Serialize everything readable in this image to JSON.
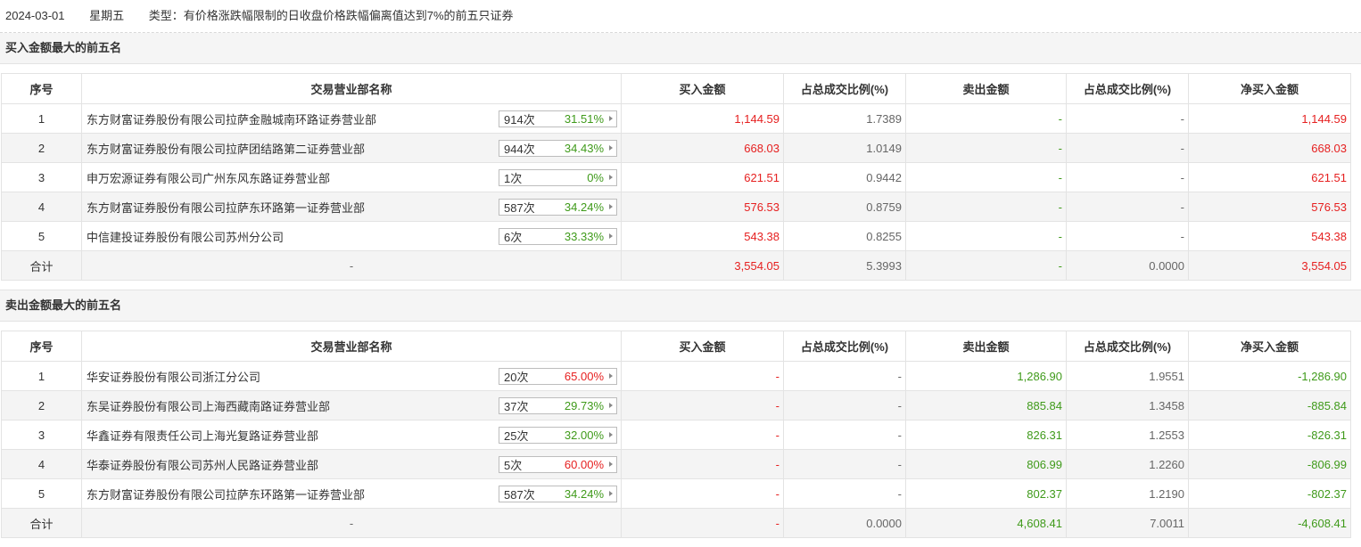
{
  "header": {
    "date": "2024-03-01",
    "weekday": "星期五",
    "type_text": "类型：有价格涨跌幅限制的日收盘价格跌幅偏离值达到7%的前五只证券"
  },
  "columns": [
    "序号",
    "交易营业部名称",
    "买入金额",
    "占总成交比例(%)",
    "卖出金额",
    "占总成交比例(%)",
    "净买入金额"
  ],
  "buy_section": {
    "title": "买入金额最大的前五名",
    "rows": [
      {
        "no": "1",
        "name": "东方财富证券股份有限公司拉萨金融城南环路证券营业部",
        "count": "914次",
        "rate": "31.51%",
        "buy": "1,144.59",
        "buy_pct": "1.7389",
        "sell": "-",
        "sell_pct": "-",
        "net": "1,144.59"
      },
      {
        "no": "2",
        "name": "东方财富证券股份有限公司拉萨团结路第二证券营业部",
        "count": "944次",
        "rate": "34.43%",
        "buy": "668.03",
        "buy_pct": "1.0149",
        "sell": "-",
        "sell_pct": "-",
        "net": "668.03"
      },
      {
        "no": "3",
        "name": "申万宏源证券有限公司广州东风东路证券营业部",
        "count": "1次",
        "rate": "0%",
        "buy": "621.51",
        "buy_pct": "0.9442",
        "sell": "-",
        "sell_pct": "-",
        "net": "621.51"
      },
      {
        "no": "4",
        "name": "东方财富证券股份有限公司拉萨东环路第一证券营业部",
        "count": "587次",
        "rate": "34.24%",
        "buy": "576.53",
        "buy_pct": "0.8759",
        "sell": "-",
        "sell_pct": "-",
        "net": "576.53"
      },
      {
        "no": "5",
        "name": "中信建投证券股份有限公司苏州分公司",
        "count": "6次",
        "rate": "33.33%",
        "buy": "543.38",
        "buy_pct": "0.8255",
        "sell": "-",
        "sell_pct": "-",
        "net": "543.38"
      }
    ],
    "total": {
      "label": "合计",
      "name": "-",
      "buy": "3,554.05",
      "buy_pct": "5.3993",
      "sell": "-",
      "sell_pct": "0.0000",
      "net": "3,554.05"
    }
  },
  "sell_section": {
    "title": "卖出金额最大的前五名",
    "rows": [
      {
        "no": "1",
        "name": "华安证券股份有限公司浙江分公司",
        "count": "20次",
        "rate": "65.00%",
        "buy": "-",
        "buy_pct": "-",
        "sell": "1,286.90",
        "sell_pct": "1.9551",
        "net": "-1,286.90"
      },
      {
        "no": "2",
        "name": "东吴证券股份有限公司上海西藏南路证券营业部",
        "count": "37次",
        "rate": "29.73%",
        "buy": "-",
        "buy_pct": "-",
        "sell": "885.84",
        "sell_pct": "1.3458",
        "net": "-885.84"
      },
      {
        "no": "3",
        "name": "华鑫证券有限责任公司上海光复路证券营业部",
        "count": "25次",
        "rate": "32.00%",
        "buy": "-",
        "buy_pct": "-",
        "sell": "826.31",
        "sell_pct": "1.2553",
        "net": "-826.31"
      },
      {
        "no": "4",
        "name": "华泰证券股份有限公司苏州人民路证券营业部",
        "count": "5次",
        "rate": "60.00%",
        "buy": "-",
        "buy_pct": "-",
        "sell": "806.99",
        "sell_pct": "1.2260",
        "net": "-806.99"
      },
      {
        "no": "5",
        "name": "东方财富证券股份有限公司拉萨东环路第一证券营业部",
        "count": "587次",
        "rate": "34.24%",
        "buy": "-",
        "buy_pct": "-",
        "sell": "802.37",
        "sell_pct": "1.2190",
        "net": "-802.37"
      }
    ],
    "total": {
      "label": "合计",
      "name": "-",
      "buy": "-",
      "buy_pct": "0.0000",
      "sell": "4,608.41",
      "sell_pct": "7.0011",
      "net": "-4,608.41"
    }
  },
  "colors": {
    "red": "#e62020",
    "green": "#3f9a1a"
  }
}
